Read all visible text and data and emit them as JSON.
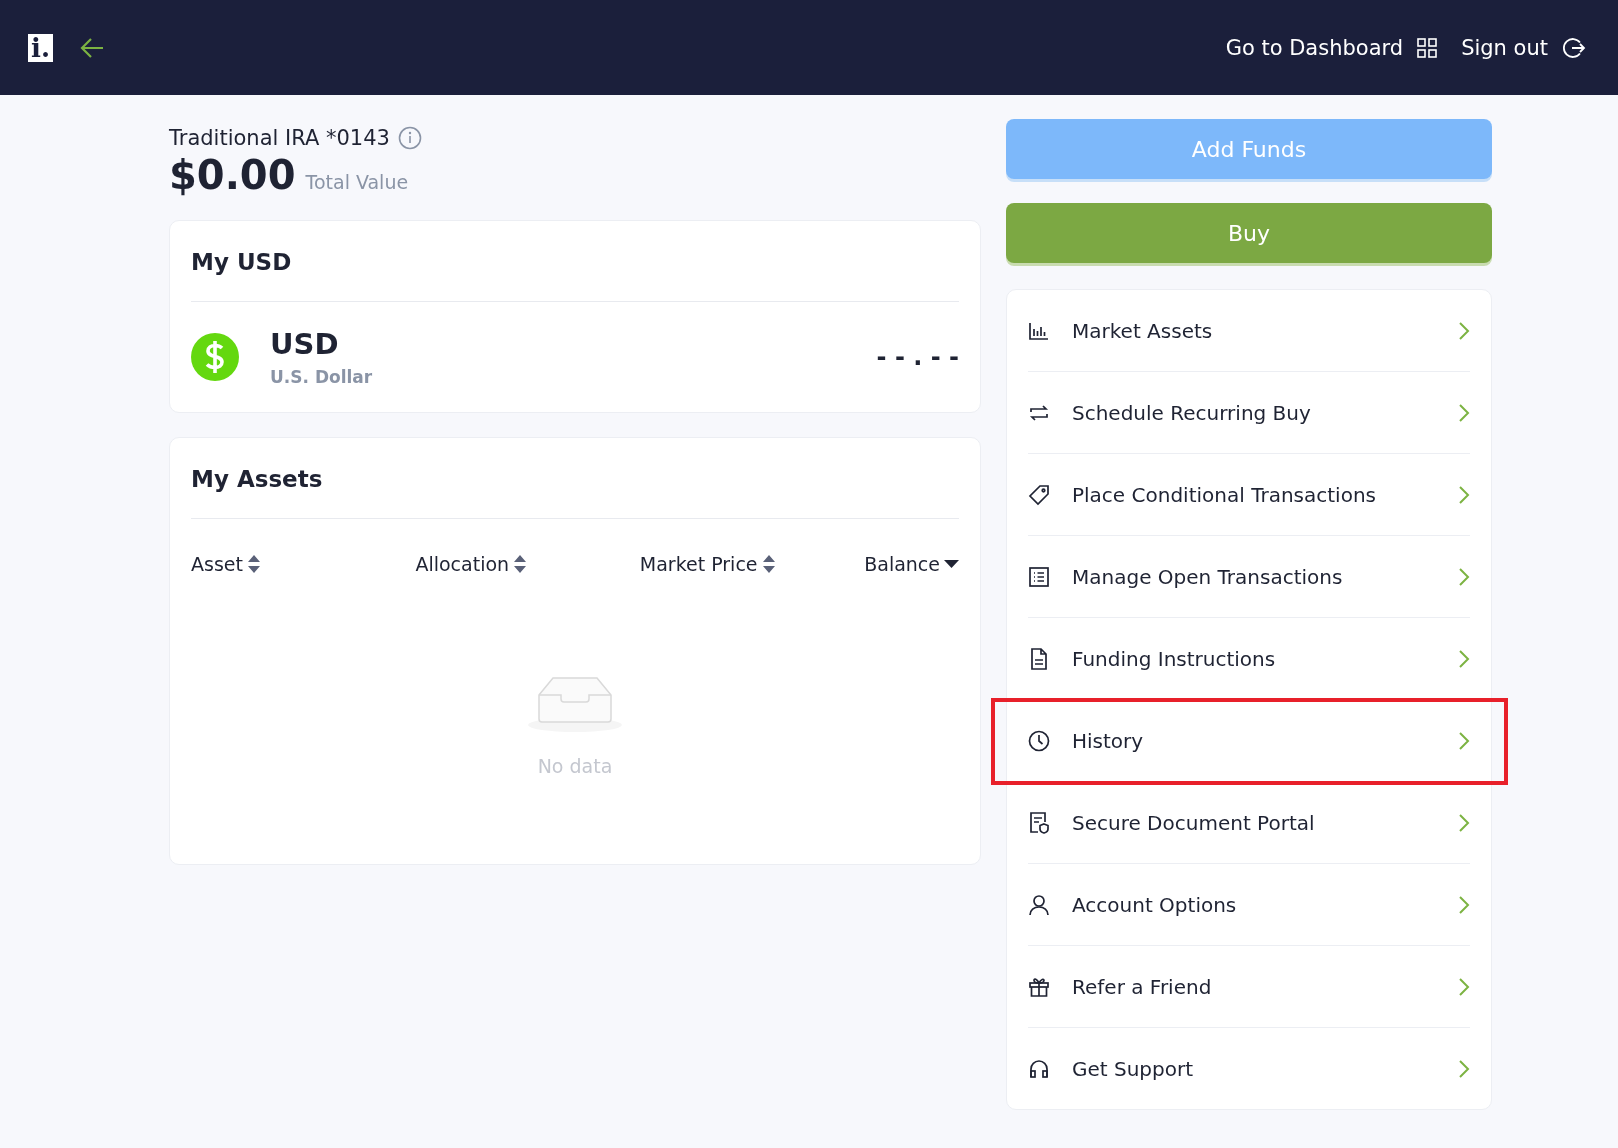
{
  "header": {
    "logo": "i.",
    "nav": [
      {
        "label": "Go to Dashboard"
      },
      {
        "label": "Sign out"
      }
    ]
  },
  "account": {
    "name": "Traditional IRA *0143",
    "total": "$0.00",
    "total_label": "Total Value"
  },
  "usd_card": {
    "title": "My USD",
    "currency": "USD",
    "currency_name": "U.S. Dollar",
    "balance": "- - . - -"
  },
  "assets_card": {
    "title": "My Assets",
    "columns": [
      {
        "label": "Asset",
        "sorted": false
      },
      {
        "label": "Allocation",
        "sorted": false
      },
      {
        "label": "Market Price",
        "sorted": false
      },
      {
        "label": "Balance",
        "sorted": true
      }
    ],
    "empty_text": "No data"
  },
  "buttons": [
    {
      "label": "Add Funds",
      "kind": "secondary"
    },
    {
      "label": "Buy",
      "kind": "primary"
    }
  ],
  "menu": [
    {
      "label": "Market Assets",
      "highlighted": false
    },
    {
      "label": "Schedule Recurring Buy",
      "highlighted": false
    },
    {
      "label": "Place Conditional Transactions",
      "highlighted": false
    },
    {
      "label": "Manage Open Transactions",
      "highlighted": false
    },
    {
      "label": "Funding Instructions",
      "highlighted": false
    },
    {
      "label": "History",
      "highlighted": true
    },
    {
      "label": "Secure Document Portal",
      "highlighted": false
    },
    {
      "label": "Account Options",
      "highlighted": false
    },
    {
      "label": "Refer a Friend",
      "highlighted": false
    },
    {
      "label": "Get Support",
      "highlighted": false
    }
  ]
}
